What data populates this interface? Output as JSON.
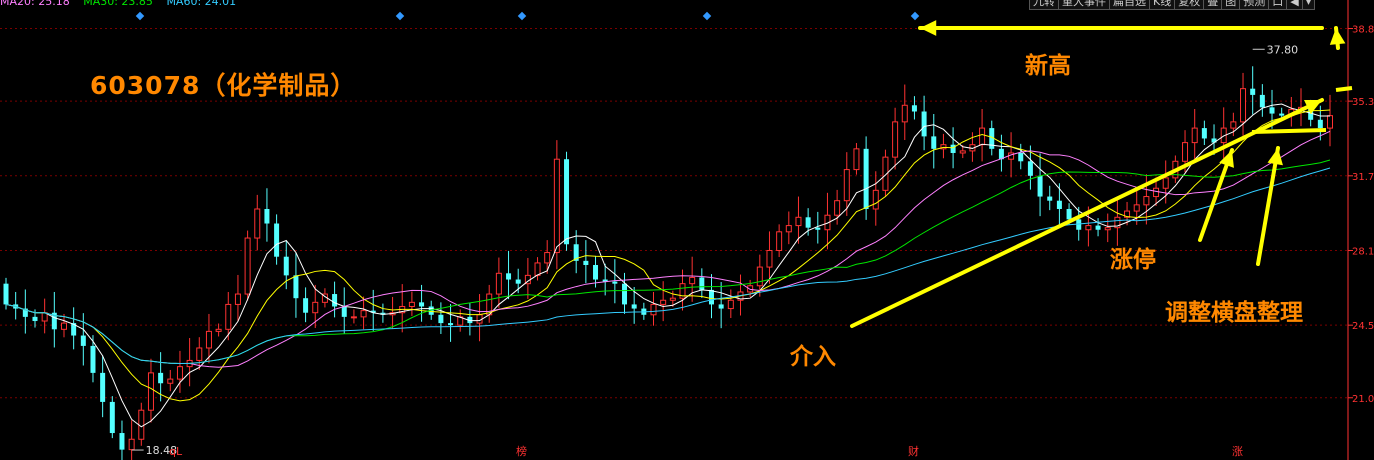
{
  "legend": {
    "ma20": "MA20: 25.18",
    "ma30": "MA30: 23.85",
    "ma60": "MA60: 24.01"
  },
  "toolbar": [
    "九转",
    "重大事件",
    "扁自选",
    "K线",
    "复权",
    "叠",
    "图",
    "预测",
    "口",
    "◀",
    "▾"
  ],
  "title": "603078（化学制品）",
  "annotations": {
    "new_high": "新高",
    "limit_up": "涨停",
    "entry": "介入",
    "consolidation": "调整横盘整理"
  },
  "markers": {
    "high_label": "37.80",
    "low_label": "18.48",
    "events": [
      "qL",
      "榜",
      "财",
      "涨"
    ]
  },
  "colors": {
    "up": "#ff3232",
    "down": "#54ffff",
    "ma5": "#ffffff",
    "ma10": "#ffff00",
    "ma20": "#ff80ff",
    "ma30": "#00e600",
    "ma60": "#33ccff",
    "annotation": "#ff8800",
    "arrow": "#ffff00",
    "axis": "#ff3232",
    "grid": "#7a0000"
  },
  "chart_data": {
    "type": "candlestick",
    "ylim": [
      18.0,
      39.5
    ],
    "yticks": [
      "38.8",
      "35.3",
      "31.7",
      "28.1",
      "24.5",
      "21.0"
    ],
    "grid": true,
    "ohlc_open": [
      26.5,
      25.5,
      25.3,
      24.9,
      24.7,
      25.1,
      24.3,
      24.6,
      24.0,
      23.5,
      22.2,
      20.8,
      19.3,
      18.5,
      19.0,
      20.4,
      22.2,
      21.7,
      21.9,
      22.5,
      22.8,
      23.4,
      24.2,
      24.3,
      25.5,
      26.0,
      28.7,
      30.1,
      29.4,
      27.8,
      26.9,
      25.8,
      25.1,
      25.6,
      26.0,
      25.4,
      24.9,
      24.9,
      25.2,
      25.1,
      25.0,
      25.1,
      25.4,
      25.6,
      25.4,
      25.0,
      24.6,
      24.5,
      24.9,
      24.6,
      25.0,
      26.0,
      27.0,
      26.7,
      26.5,
      26.9,
      27.5,
      28.0,
      32.5,
      28.4,
      27.6,
      27.4,
      26.7,
      26.6,
      26.5,
      25.5,
      25.3,
      25.0,
      25.5,
      25.7,
      25.8,
      26.5,
      26.8,
      26.2,
      25.5,
      25.3,
      25.7,
      26.1,
      26.4,
      27.3,
      28.1,
      29.0,
      29.3,
      29.7,
      29.2,
      29.1,
      29.8,
      30.5,
      32.0,
      33.0,
      30.1,
      31.0,
      32.6,
      34.3,
      35.1,
      34.8,
      33.6,
      33.0,
      33.2,
      32.8,
      32.9,
      33.2,
      34.0,
      33.0,
      32.5,
      32.8,
      32.4,
      31.7,
      30.7,
      30.5,
      30.1,
      29.6,
      29.1,
      29.3,
      29.1,
      29.2,
      29.7,
      30.0,
      30.3,
      30.7,
      31.1,
      31.6,
      32.4,
      33.3,
      34.0,
      33.5,
      33.3,
      34.0,
      34.3,
      35.9,
      35.6,
      35.0,
      34.7,
      34.6,
      34.9,
      35.0,
      34.4,
      34.0
    ],
    "ohlc_close": [
      25.5,
      25.3,
      24.9,
      24.7,
      25.1,
      24.3,
      24.6,
      24.0,
      23.5,
      22.2,
      20.8,
      19.3,
      18.5,
      19.0,
      20.4,
      22.2,
      21.7,
      21.9,
      22.5,
      22.8,
      23.4,
      24.2,
      24.3,
      25.5,
      26.0,
      28.7,
      30.1,
      29.4,
      27.8,
      26.9,
      25.8,
      25.1,
      25.6,
      26.0,
      25.4,
      24.9,
      24.9,
      25.2,
      25.1,
      25.0,
      25.1,
      25.4,
      25.6,
      25.4,
      25.0,
      24.6,
      24.5,
      24.9,
      24.6,
      25.0,
      26.0,
      27.0,
      26.7,
      26.5,
      26.9,
      27.5,
      28.0,
      32.5,
      28.4,
      27.6,
      27.4,
      26.7,
      26.6,
      26.5,
      25.5,
      25.3,
      25.0,
      25.5,
      25.7,
      25.8,
      26.5,
      26.8,
      26.2,
      25.5,
      25.3,
      25.7,
      26.1,
      26.4,
      27.3,
      28.1,
      29.0,
      29.3,
      29.7,
      29.2,
      29.1,
      29.8,
      30.5,
      32.0,
      33.0,
      30.1,
      31.0,
      32.6,
      34.3,
      35.1,
      34.8,
      33.6,
      33.0,
      33.2,
      32.8,
      32.9,
      33.2,
      34.0,
      33.0,
      32.5,
      32.8,
      32.4,
      31.7,
      30.7,
      30.5,
      30.1,
      29.6,
      29.1,
      29.3,
      29.1,
      29.2,
      29.7,
      30.0,
      30.3,
      30.7,
      31.1,
      31.6,
      32.4,
      33.3,
      34.0,
      33.5,
      33.3,
      34.0,
      34.3,
      35.9,
      35.6,
      35.0,
      34.7,
      34.6,
      34.9,
      35.0,
      34.4,
      34.0,
      34.6
    ],
    "ma_series": [
      {
        "name": "MA20",
        "color_key": "ma20"
      },
      {
        "name": "MA30",
        "color_key": "ma30"
      },
      {
        "name": "MA60",
        "color_key": "ma60"
      }
    ],
    "high_value": 37.8,
    "low_value": 18.48
  }
}
